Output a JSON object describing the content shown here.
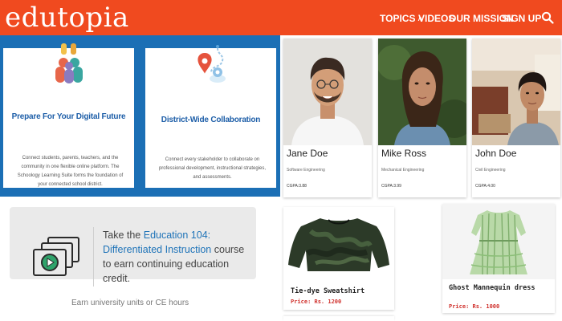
{
  "header": {
    "logo": "edutopia",
    "nav": {
      "topics": "TOPICS",
      "videos": "VIDEOS",
      "mission": "OUR MISSION",
      "signup": "SIGN UP"
    },
    "icons": {
      "topics_caret": "chevron-up-icon",
      "search": "search-icon"
    },
    "colors": {
      "brand": "#f04a1f"
    }
  },
  "features": {
    "panel_color": "#1b6fb5",
    "cards": [
      {
        "icon": "connected-people-icon",
        "title": "Prepare For Your Digital Future",
        "description": "Connect students, parents, teachers, and the community in one flexible online platform. The Schoology Learning Suite forms the foundation of your connected school district."
      },
      {
        "icon": "map-pin-route-icon",
        "title": "District-Wide Collaboration",
        "description": "Connect every stakeholder to collaborate on professional development, instructional strategies, and assessments."
      }
    ]
  },
  "profiles": [
    {
      "name": "Jane Doe",
      "major": "Software Engineering",
      "cgpa": "CGPA:3.88"
    },
    {
      "name": "Mike Ross",
      "major": "Mechanical Engineering",
      "cgpa": "CGPA:3.99"
    },
    {
      "name": "John Doe",
      "major": "Civil Engineering",
      "cgpa": "CGPA:4.00"
    }
  ],
  "education": {
    "icon": "video-stack-icon",
    "text_before": "Take the ",
    "link": "Education 104: Differentiated Instruction",
    "text_after": " course to earn continuing education credit.",
    "subtext": "Earn university units or CE hours"
  },
  "products": [
    {
      "name": "Tie-dye Sweatshirt",
      "price": "Price: Rs. 1200"
    },
    {
      "name": "Ghost Mannequin dress",
      "price": "Price: Rs. 1000"
    }
  ]
}
